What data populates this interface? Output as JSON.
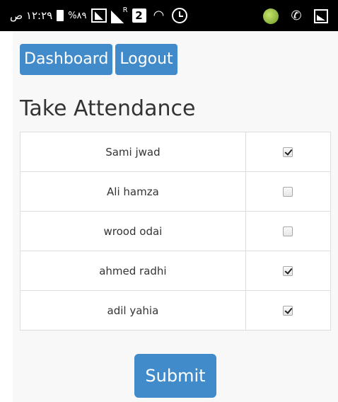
{
  "status_bar": {
    "time": "١٢:٢٩ ص",
    "battery_level": "%٨٩",
    "sim_slot": "2",
    "left_icons": [
      "battery-icon",
      "signal-icon",
      "signal-roaming-icon",
      "sim-2-icon",
      "wifi-icon",
      "alarm-icon"
    ],
    "right_icons": [
      "app-notification-icon",
      "phone-icon",
      "gallery-icon"
    ]
  },
  "nav": {
    "dashboard_label": "Dashboard",
    "logout_label": "Logout"
  },
  "page": {
    "title": "Take Attendance"
  },
  "students": [
    {
      "name": "Sami jwad",
      "present": true
    },
    {
      "name": "Ali hamza",
      "present": false
    },
    {
      "name": "wrood odai",
      "present": false
    },
    {
      "name": "ahmed radhi",
      "present": true
    },
    {
      "name": "adil yahia",
      "present": true
    }
  ],
  "form": {
    "submit_label": "Submit"
  },
  "colors": {
    "primary": "#428bca",
    "status_bar": "#000000",
    "background": "#f8f8f8",
    "table_border": "#dddddd"
  }
}
